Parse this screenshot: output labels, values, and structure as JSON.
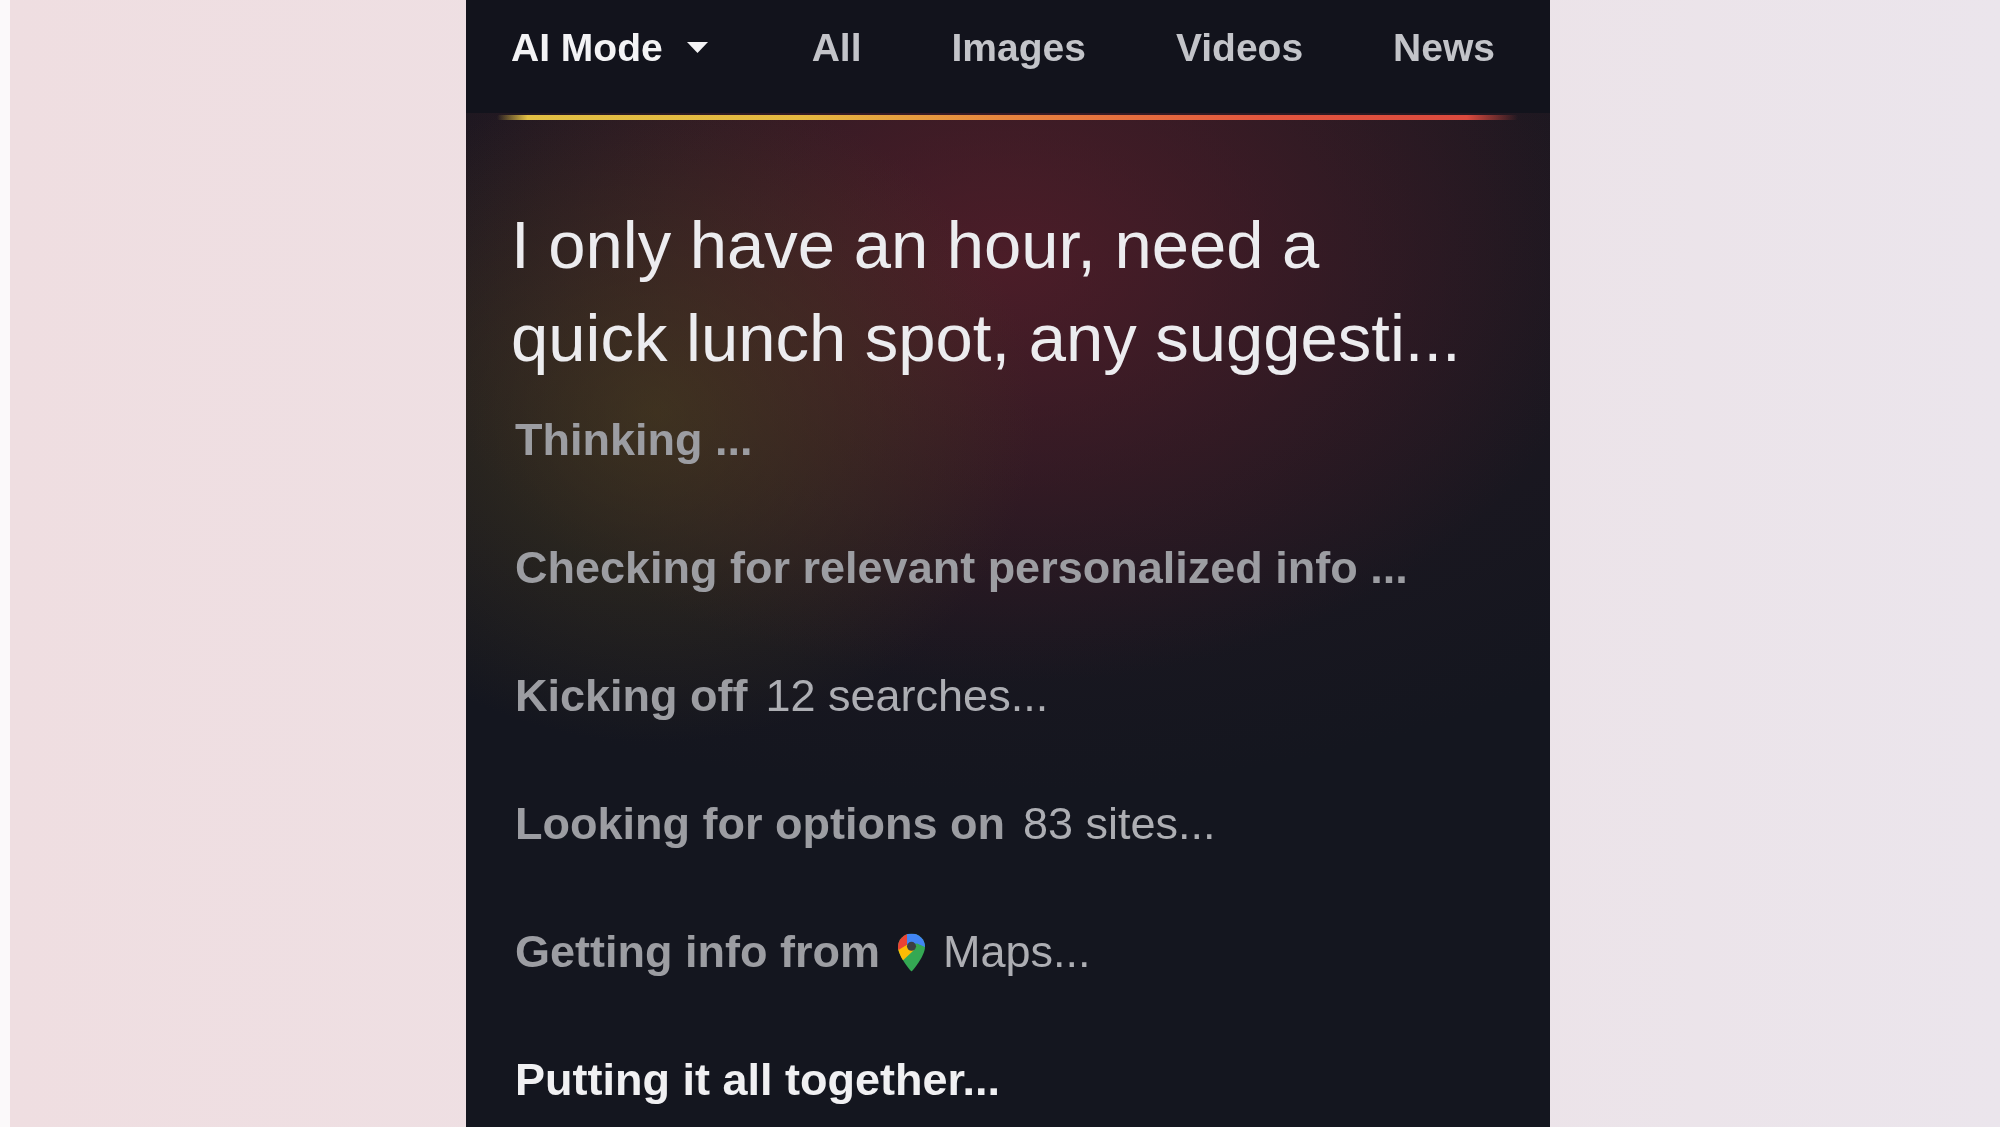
{
  "tabs": [
    {
      "label": "AI Mode",
      "selected": true,
      "dropdown": true
    },
    {
      "label": "All",
      "selected": false,
      "dropdown": false
    },
    {
      "label": "Images",
      "selected": false,
      "dropdown": false
    },
    {
      "label": "Videos",
      "selected": false,
      "dropdown": false
    },
    {
      "label": "News",
      "selected": false,
      "dropdown": false
    }
  ],
  "query": "I only have an hour, need a quick lunch spot, any suggesti...",
  "steps": [
    {
      "kind": "plain",
      "text": "Thinking ...",
      "active": false
    },
    {
      "kind": "plain",
      "text": "Checking for relevant personalized info ...",
      "active": false
    },
    {
      "kind": "count",
      "text": "Kicking off",
      "detail": "12 searches...",
      "active": false
    },
    {
      "kind": "count",
      "text": "Looking for options on",
      "detail": "83 sites...",
      "active": false
    },
    {
      "kind": "source",
      "text": "Getting info from",
      "detail": "Maps...",
      "active": false
    },
    {
      "kind": "plain",
      "text": "Putting it all together...",
      "active": true
    }
  ]
}
